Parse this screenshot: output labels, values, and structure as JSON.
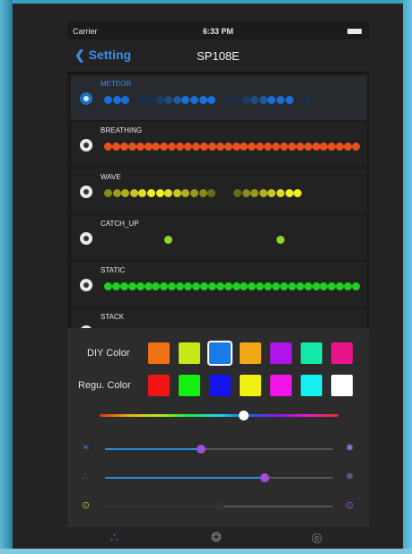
{
  "status_bar": {
    "carrier": "Carrier",
    "time": "6:33 PM"
  },
  "nav": {
    "back_label": "Setting",
    "title": "SP108E"
  },
  "modes": [
    {
      "id": "meteor",
      "label": "METEOR",
      "selected": true,
      "dots": [
        "#1a6fd9",
        "#1a6fd9",
        "#1a6fd9",
        null,
        "#1b2f4a",
        "#1b2f4a",
        "#1c3d66",
        "#1c4c80",
        "#1c5ca0",
        "#1a6fd9",
        "#1a6fd9",
        "#1a6fd9",
        "#1a6fd9",
        null,
        "#1b2f4a",
        "#1b2f4a",
        "#1c3d66",
        "#1c4c80",
        "#1c5ca0",
        "#1a6fd9",
        "#1a6fd9",
        "#1a6fd9",
        null,
        "#1b2f4a"
      ]
    },
    {
      "id": "breathing",
      "label": "BREATHING",
      "selected": false,
      "dots": [
        "#e8521a",
        "#e8521a",
        "#e8521a",
        "#e8521a",
        "#e8521a",
        "#e8521a",
        "#e8521a",
        "#e8521a",
        "#e8521a",
        "#e8521a",
        "#e8521a",
        "#e8521a",
        "#e8521a",
        "#e8521a",
        "#e8521a",
        "#e8521a",
        "#e8521a",
        "#e8521a",
        "#e8521a",
        "#e8521a",
        "#e8521a",
        "#e8521a",
        "#e8521a",
        "#e8521a",
        "#e8521a",
        "#e8521a",
        "#e8521a",
        "#e8521a",
        "#e8521a",
        "#e8521a",
        "#e8521a",
        "#e8521a"
      ]
    },
    {
      "id": "wave",
      "label": "WAVE",
      "selected": false,
      "dots": [
        "#8a8a1a",
        "#9a9a1c",
        "#b0b01e",
        "#c8c820",
        "#e0e022",
        "#f0f024",
        "#f0f024",
        "#e0e022",
        "#c8c820",
        "#b0b01e",
        "#9a9a1c",
        "#8a8a1a",
        "#6c6c16",
        null,
        null,
        "#6c6c16",
        "#8a8a1a",
        "#9a9a1c",
        "#b0b01e",
        "#c8c820",
        "#e0e022",
        "#f0f024",
        "#f0f024"
      ]
    },
    {
      "id": "catch_up",
      "label": "CATCH_UP",
      "selected": false,
      "dots": [
        null,
        null,
        null,
        null,
        null,
        null,
        null,
        "#8ad92a",
        null,
        null,
        null,
        null,
        null,
        null,
        null,
        null,
        null,
        null,
        null,
        null,
        "#8ad92a"
      ]
    },
    {
      "id": "static",
      "label": "STATIC",
      "selected": false,
      "dots": [
        "#20d020",
        "#20d020",
        "#20d020",
        "#20d020",
        "#20d020",
        "#20d020",
        "#20d020",
        "#20d020",
        "#20d020",
        "#20d020",
        "#20d020",
        "#20d020",
        "#20d020",
        "#20d020",
        "#20d020",
        "#20d020",
        "#20d020",
        "#20d020",
        "#20d020",
        "#20d020",
        "#20d020",
        "#20d020",
        "#20d020",
        "#20d020",
        "#20d020",
        "#20d020",
        "#20d020",
        "#20d020",
        "#20d020",
        "#20d020",
        "#20d020",
        "#20d020"
      ]
    },
    {
      "id": "stack",
      "label": "STACK",
      "selected": false,
      "dots": []
    }
  ],
  "color_panel": {
    "diy_label": "DIY Color",
    "diy_colors": [
      "#f07014",
      "#c8e81a",
      "#1a7ce8",
      "#f0a814",
      "#b014e8",
      "#14e8a8",
      "#e8148a"
    ],
    "diy_selected_index": 2,
    "regular_label": "Regu. Color",
    "regular_colors": [
      "#f01414",
      "#14f014",
      "#1414f0",
      "#f0f014",
      "#f014e8",
      "#14f0f0",
      "#ffffff"
    ],
    "hue_position": 0.6
  },
  "sliders": [
    {
      "id": "brightness",
      "icon_left": "sun-dim-icon",
      "icon_right": "sun-bright-icon",
      "value": 0.42,
      "fill": "#2f8cd8",
      "thumb": "#a24fd8"
    },
    {
      "id": "speed",
      "icon_left": "sparkle-dim-icon",
      "icon_right": "sparkle-bright-icon",
      "value": 0.7,
      "fill": "#2f8cd8",
      "thumb": "#a24fd8"
    },
    {
      "id": "segments",
      "icon_left": "bulb-dim-icon",
      "icon_right": "bulb-bright-icon",
      "value": 0.5,
      "fill": "#333333",
      "thumb": "#333333"
    }
  ],
  "tabs": [
    {
      "id": "effects",
      "icon": "circles-icon",
      "active": true
    },
    {
      "id": "colors",
      "icon": "rgb-icon",
      "active": false
    },
    {
      "id": "settings",
      "icon": "target-icon",
      "active": false
    }
  ],
  "colors": {
    "accent": "#3d8ee8",
    "panel": "#2c2c2c",
    "background": "#1b1b1b"
  }
}
